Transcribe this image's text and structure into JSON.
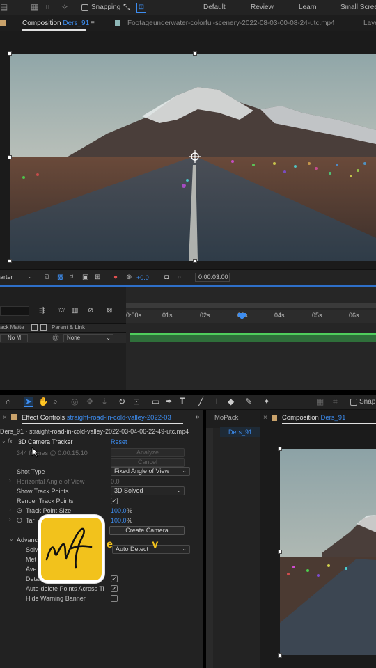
{
  "topbar": {
    "snapping": "Snapping",
    "workspaces": [
      "Default",
      "Review",
      "Learn",
      "Small Screen"
    ]
  },
  "composition_tab": {
    "label": "Composition",
    "name": "Ders_91"
  },
  "footage_tab": {
    "label": "Footage",
    "file": "underwater-colorful-scenery-2022-08-03-00-08-24-utc.mp4"
  },
  "layers_tab": {
    "label": "Laye"
  },
  "viewer_bar": {
    "renderer": "arter",
    "exposure": "+0.0",
    "timecode": "0:00:03:00"
  },
  "timeline": {
    "ticks": [
      "0:00s",
      "01s",
      "02s",
      "03s",
      "04s",
      "05s",
      "06s"
    ],
    "columns": {
      "track_matte": "ack Matte",
      "parent_link": "Parent & Link"
    },
    "layer_row": {
      "matte": "No M",
      "parent": "None"
    }
  },
  "toolbar2": {
    "snapping": "Snapp"
  },
  "effect_controls": {
    "tab_label": "Effect Controls",
    "tab_file": "straight-road-in-cold-valley-2022-03",
    "source": "Ders_91 · straight-road-in-cold-valley-2022-03-04-06-22-49-utc.mp4",
    "effect_name": "3D Camera Tracker",
    "reset": "Reset",
    "analyze": "Analyze",
    "cancel": "Cancel",
    "status": "344 frames @ 0:00:15:10",
    "props": {
      "shot_type": {
        "label": "Shot Type",
        "value": "Fixed Angle of View"
      },
      "hfov": {
        "label": "Horizontal Angle of View",
        "value": "0.0"
      },
      "show_track_points": {
        "label": "Show Track Points",
        "value": "3D Solved"
      },
      "render_track_points": {
        "label": "Render Track Points"
      },
      "track_point_size": {
        "label": "Track Point Size",
        "value": "100.0",
        "unit": "%"
      },
      "target_size": {
        "label": "Tar",
        "value": "100.0",
        "unit": "%"
      },
      "create_camera": "Create Camera",
      "advanced": {
        "label": "Advanc"
      },
      "solve_method": {
        "label": "Solv",
        "value": "Auto Detect"
      },
      "method": {
        "label": "Met"
      },
      "average": {
        "label": "Ave"
      },
      "detailed": {
        "label": "Detailed Analy"
      },
      "auto_delete": {
        "label": "Auto-delete Points Across Ti"
      },
      "hide_warning": {
        "label": "Hide Warning Banner"
      }
    }
  },
  "mopack_tab": {
    "label": "MoPack"
  },
  "composition2_tab": {
    "label": "Composition",
    "name": "Ders_91",
    "subtab": "Ders_91"
  },
  "watermark": {
    "text": "e v"
  },
  "colors": {
    "accent_blue": "#3d8df0",
    "logo_yellow": "#f2c21c",
    "track_green": "#4fce5c"
  }
}
